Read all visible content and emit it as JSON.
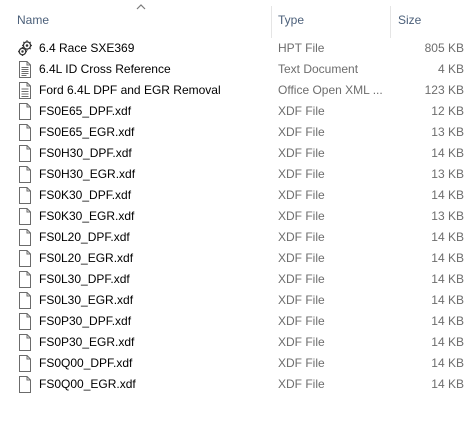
{
  "columns": {
    "name": "Name",
    "type": "Type",
    "size": "Size"
  },
  "sort": {
    "column": "name",
    "direction": "ascending",
    "icon": "chevron-up-icon"
  },
  "files": [
    {
      "name": "6.4 Race SXE369",
      "type": "HPT File",
      "size": "805 KB",
      "icon": "hpt-file-icon"
    },
    {
      "name": "6.4L ID Cross Reference",
      "type": "Text Document",
      "size": "4 KB",
      "icon": "text-document-icon"
    },
    {
      "name": "Ford 6.4L DPF and EGR Removal",
      "type": "Office Open XML ...",
      "size": "123 KB",
      "icon": "word-document-icon"
    },
    {
      "name": "FS0E65_DPF.xdf",
      "type": "XDF File",
      "size": "12 KB",
      "icon": "blank-file-icon"
    },
    {
      "name": "FS0E65_EGR.xdf",
      "type": "XDF File",
      "size": "13 KB",
      "icon": "blank-file-icon"
    },
    {
      "name": "FS0H30_DPF.xdf",
      "type": "XDF File",
      "size": "14 KB",
      "icon": "blank-file-icon"
    },
    {
      "name": "FS0H30_EGR.xdf",
      "type": "XDF File",
      "size": "13 KB",
      "icon": "blank-file-icon"
    },
    {
      "name": "FS0K30_DPF.xdf",
      "type": "XDF File",
      "size": "14 KB",
      "icon": "blank-file-icon"
    },
    {
      "name": "FS0K30_EGR.xdf",
      "type": "XDF File",
      "size": "13 KB",
      "icon": "blank-file-icon"
    },
    {
      "name": "FS0L20_DPF.xdf",
      "type": "XDF File",
      "size": "14 KB",
      "icon": "blank-file-icon"
    },
    {
      "name": "FS0L20_EGR.xdf",
      "type": "XDF File",
      "size": "14 KB",
      "icon": "blank-file-icon"
    },
    {
      "name": "FS0L30_DPF.xdf",
      "type": "XDF File",
      "size": "14 KB",
      "icon": "blank-file-icon"
    },
    {
      "name": "FS0L30_EGR.xdf",
      "type": "XDF File",
      "size": "14 KB",
      "icon": "blank-file-icon"
    },
    {
      "name": "FS0P30_DPF.xdf",
      "type": "XDF File",
      "size": "14 KB",
      "icon": "blank-file-icon"
    },
    {
      "name": "FS0P30_EGR.xdf",
      "type": "XDF File",
      "size": "14 KB",
      "icon": "blank-file-icon"
    },
    {
      "name": "FS0Q00_DPF.xdf",
      "type": "XDF File",
      "size": "14 KB",
      "icon": "blank-file-icon"
    },
    {
      "name": "FS0Q00_EGR.xdf",
      "type": "XDF File",
      "size": "14 KB",
      "icon": "blank-file-icon"
    }
  ]
}
